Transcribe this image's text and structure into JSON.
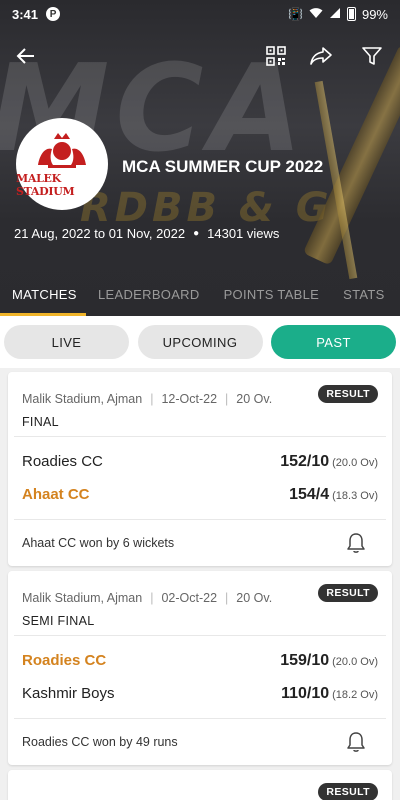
{
  "status_bar": {
    "time": "3:41",
    "battery": "99%"
  },
  "tournament": {
    "title": "MCA SUMMER CUP 2022",
    "logo_text": "MALEK STADIUM",
    "dates": "21 Aug, 2022 to 01 Nov, 2022",
    "views": "14301 views",
    "watermark": "MCA",
    "watermark_sub": "RDBB & G"
  },
  "tabs": [
    {
      "label": "MATCHES",
      "active": true
    },
    {
      "label": "LEADERBOARD",
      "active": false
    },
    {
      "label": "POINTS TABLE",
      "active": false
    },
    {
      "label": "STATS",
      "active": false
    }
  ],
  "filters": [
    {
      "label": "LIVE",
      "active": false
    },
    {
      "label": "UPCOMING",
      "active": false
    },
    {
      "label": "PAST",
      "active": true
    }
  ],
  "colors": {
    "accent_green": "#1bae8a",
    "winner_orange": "#d4831f",
    "tab_indicator": "#f0b429"
  },
  "matches": [
    {
      "venue": "Malik Stadium, Ajman",
      "date": "12-Oct-22",
      "overs": "20 Ov.",
      "stage": "FINAL",
      "badge": "RESULT",
      "team1": {
        "name": "Roadies CC",
        "score": "152/10",
        "overs": "(20.0 Ov)",
        "winner": false
      },
      "team2": {
        "name": "Ahaat CC",
        "score": "154/4",
        "overs": "(18.3 Ov)",
        "winner": true
      },
      "result": "Ahaat CC won by 6 wickets"
    },
    {
      "venue": "Malik Stadium, Ajman",
      "date": "02-Oct-22",
      "overs": "20 Ov.",
      "stage": "SEMI FINAL",
      "badge": "RESULT",
      "team1": {
        "name": "Roadies CC",
        "score": "159/10",
        "overs": "(20.0 Ov)",
        "winner": true
      },
      "team2": {
        "name": "Kashmir Boys",
        "score": "110/10",
        "overs": "(18.2 Ov)",
        "winner": false
      },
      "result": "Roadies CC won by 49 runs"
    },
    {
      "badge": "RESULT"
    }
  ]
}
